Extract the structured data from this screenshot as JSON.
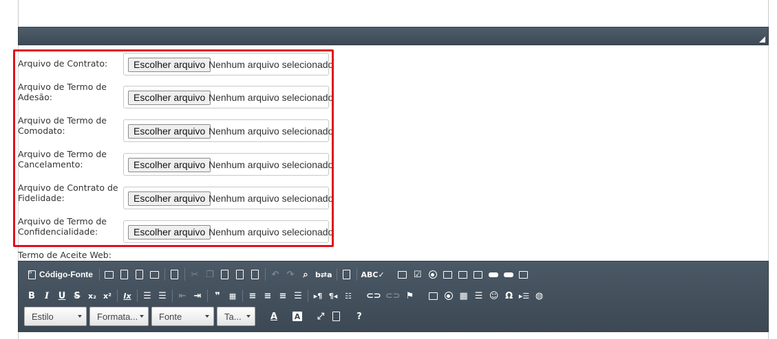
{
  "file_fields": [
    {
      "label": "Arquivo de Contrato:",
      "button": "Escolher arquivo",
      "status": "Nenhum arquivo selecionado"
    },
    {
      "label": "Arquivo de Termo de Adesão:",
      "button": "Escolher arquivo",
      "status": "Nenhum arquivo selecionado"
    },
    {
      "label": "Arquivo de Termo de Comodato:",
      "button": "Escolher arquivo",
      "status": "Nenhum arquivo selecionado"
    },
    {
      "label": "Arquivo de Termo de Cancelamento:",
      "button": "Escolher arquivo",
      "status": "Nenhum arquivo selecionado"
    },
    {
      "label": "Arquivo de Contrato de Fidelidade:",
      "button": "Escolher arquivo",
      "status": "Nenhum arquivo selecionado"
    },
    {
      "label": "Arquivo de Termo de Confidencialidade:",
      "button": "Escolher arquivo",
      "status": "Nenhum arquivo selecionado"
    }
  ],
  "aceite": {
    "label": "Termo de Aceite Web:"
  },
  "toolbar": {
    "source_label": "Código-Fonte",
    "combos": {
      "style": "Estilo",
      "format": "Formata...",
      "font": "Fonte",
      "size": "Ta..."
    },
    "glyphs": {
      "bold": "B",
      "italic": "I",
      "underline": "U",
      "strike": "S",
      "subscript": "x₂",
      "superscript": "x²",
      "remove_format": "Ix",
      "blockquote": "❞",
      "ltr": "▸¶",
      "rtl": "¶◂",
      "text_color": "A",
      "bg_color": "A",
      "help": "?",
      "omega": "Ω",
      "smiley": "☺"
    }
  },
  "colors": {
    "highlight": "#e0101a",
    "toolbar": "#44515d"
  }
}
